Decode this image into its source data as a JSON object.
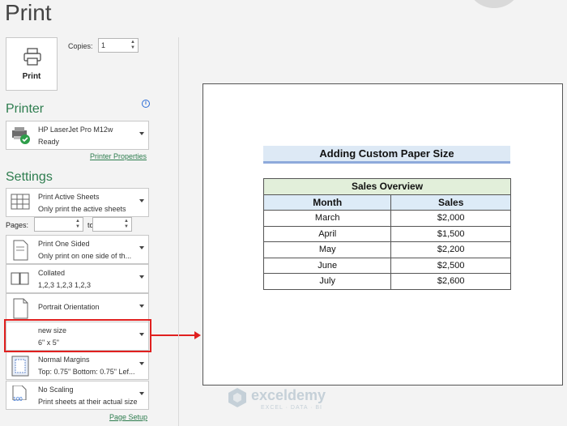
{
  "header": {
    "title": "Print"
  },
  "print_button": {
    "label": "Print"
  },
  "copies": {
    "label": "Copies:",
    "value": "1"
  },
  "printer": {
    "heading": "Printer",
    "name": "HP LaserJet Pro M12w",
    "status": "Ready",
    "properties_link": "Printer Properties"
  },
  "settings": {
    "heading": "Settings",
    "scope": {
      "line1": "Print Active Sheets",
      "line2": "Only print the active sheets"
    },
    "pages": {
      "label": "Pages:",
      "from": "",
      "to_label": "to",
      "to": ""
    },
    "sides": {
      "line1": "Print One Sided",
      "line2": "Only print on one side of th..."
    },
    "collation": {
      "line1": "Collated",
      "line2": "1,2,3    1,2,3    1,2,3"
    },
    "orientation": {
      "line1": "Portrait Orientation"
    },
    "paper_size": {
      "line1": "new size",
      "line2": "6\" x 5\""
    },
    "margins": {
      "line1": "Normal Margins",
      "line2": "Top: 0.75\" Bottom: 0.75\" Lef..."
    },
    "scaling": {
      "line1": "No Scaling",
      "line2": "Print sheets at their actual size",
      "icon_text": "100"
    },
    "page_setup_link": "Page Setup"
  },
  "preview": {
    "sheet_title": "Adding Custom Paper Size",
    "table_caption": "Sales Overview",
    "columns": [
      "Month",
      "Sales"
    ],
    "rows": [
      [
        "March",
        "$2,000"
      ],
      [
        "April",
        "$1,500"
      ],
      [
        "May",
        "$2,200"
      ],
      [
        "June",
        "$2,500"
      ],
      [
        "July",
        "$2,600"
      ]
    ]
  },
  "watermark": {
    "name": "exceldemy",
    "tagline": "EXCEL · DATA · BI"
  },
  "colors": {
    "accent_green": "#2e7d4f",
    "highlight_red": "#e0201f"
  }
}
